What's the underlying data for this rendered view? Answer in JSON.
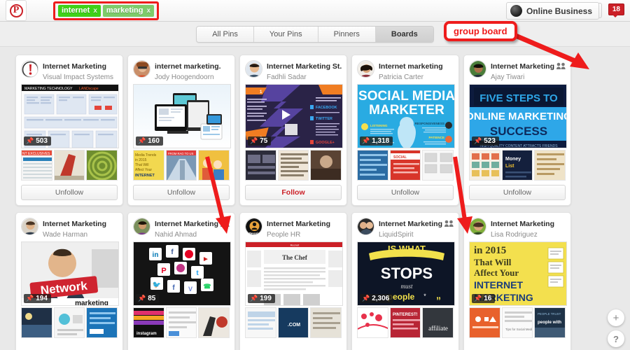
{
  "header": {
    "logo_icon": "pinterest-logo-icon",
    "search_tokens": [
      {
        "label": "internet",
        "remove": "x",
        "color": "#3fd119"
      },
      {
        "label": "marketing",
        "remove": "x",
        "color": "#7ecb6a"
      }
    ],
    "search_value": "",
    "search_placeholder": "",
    "clear_icon": "close-icon",
    "menu_icon": "hamburger-menu-icon",
    "user_name": "Online Business",
    "notification_count": "18"
  },
  "tabs": [
    {
      "label": "All Pins",
      "selected": false
    },
    {
      "label": "Your Pins",
      "selected": false
    },
    {
      "label": "Pinners",
      "selected": false
    },
    {
      "label": "Boards",
      "selected": true
    }
  ],
  "annotation": {
    "label": "group board",
    "color": "#ee1c1c"
  },
  "floating": {
    "add_label": "+",
    "help_label": "?"
  },
  "boards": [
    {
      "board_name": "Internet Marketing",
      "owner": "Visual Impact Systems",
      "pin_count": "503",
      "follow_label": "Unfollow",
      "is_following": true,
      "is_group": false,
      "cover_style": "landscape",
      "cover_title": "MARKETING TECHNOLOGY LANDSCAPE"
    },
    {
      "board_name": "internet marketing.",
      "owner": "Jody Hoogendoorn",
      "pin_count": "160",
      "follow_label": "Unfollow",
      "is_following": true,
      "is_group": false,
      "cover_style": "devices",
      "cover_title": ""
    },
    {
      "board_name": "Internet Marketing St...",
      "owner": "Fadhli Sadar",
      "pin_count": "75",
      "follow_label": "Follow",
      "is_following": false,
      "is_group": false,
      "cover_style": "purple-steps",
      "cover_title": ""
    },
    {
      "board_name": "Internet marketing",
      "owner": "Patricia Carter",
      "pin_count": "1,318",
      "follow_label": "Unfollow",
      "is_following": true,
      "is_group": false,
      "cover_style": "social-media-marketer",
      "cover_title": "SOCIAL MEDIA MARKETER"
    },
    {
      "board_name": "Internet Marketing",
      "owner": "Ajay Tiwari",
      "pin_count": "523",
      "follow_label": "Unfollow",
      "is_following": true,
      "is_group": true,
      "cover_style": "five-steps",
      "cover_title": "FIVE STEPS TO ONLINE MARKETING SUCCESS"
    },
    {
      "board_name": "Internet Marketing",
      "owner": "Wade Harman",
      "pin_count": "194",
      "follow_label": "",
      "is_following": true,
      "is_group": false,
      "cover_style": "network",
      "cover_title": "Network marketing"
    },
    {
      "board_name": "Internet Marketing",
      "owner": "Nahid Ahmad",
      "pin_count": "85",
      "follow_label": "",
      "is_following": true,
      "is_group": true,
      "cover_style": "social-icons",
      "cover_title": ""
    },
    {
      "board_name": "Internet Marketing",
      "owner": "People HR",
      "pin_count": "199",
      "follow_label": "",
      "is_following": true,
      "is_group": false,
      "cover_style": "article",
      "cover_title": "The Chef"
    },
    {
      "board_name": "Internet Marketing",
      "owner": "LiquidSpirit",
      "pin_count": "2,306",
      "follow_label": "",
      "is_following": true,
      "is_group": true,
      "cover_style": "stops-people",
      "cover_title": "STOPS must people"
    },
    {
      "board_name": "Internet Marketing",
      "owner": "Lisa Rodriguez",
      "pin_count": "16",
      "follow_label": "",
      "is_following": true,
      "is_group": false,
      "cover_style": "in-2015",
      "cover_title": "in 2015 That Will Affect Your INTERNET MARKETING"
    }
  ]
}
